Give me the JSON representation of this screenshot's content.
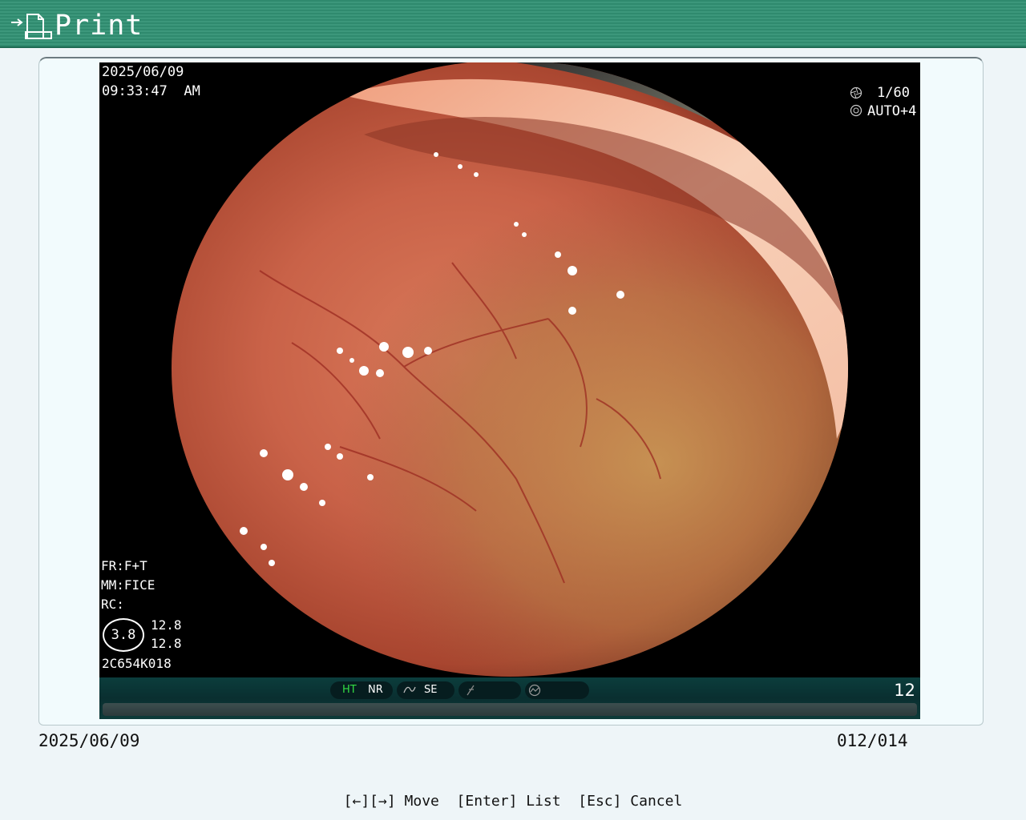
{
  "title_bar": {
    "title": "Print",
    "icon": "print-page-icon"
  },
  "image": {
    "date": "2025/06/09",
    "time": "09:33:47  AM",
    "shutter": "1/60",
    "exposure": "AUTO+4",
    "fr": "FR:F+T",
    "mm": "MM:FICE",
    "rc": "RC:",
    "circle_value": "3.8",
    "value_top": "12.8",
    "value_bottom": "12.8",
    "code": "2C654K018",
    "status": {
      "ht": "HT",
      "nr": "NR",
      "se": "SE",
      "page": "12",
      "ht_color": "#33dd44"
    }
  },
  "footer": {
    "date": "2025/06/09",
    "counter": "012/014"
  },
  "help_text": "[←][→] Move  [Enter] List  [Esc] Cancel"
}
